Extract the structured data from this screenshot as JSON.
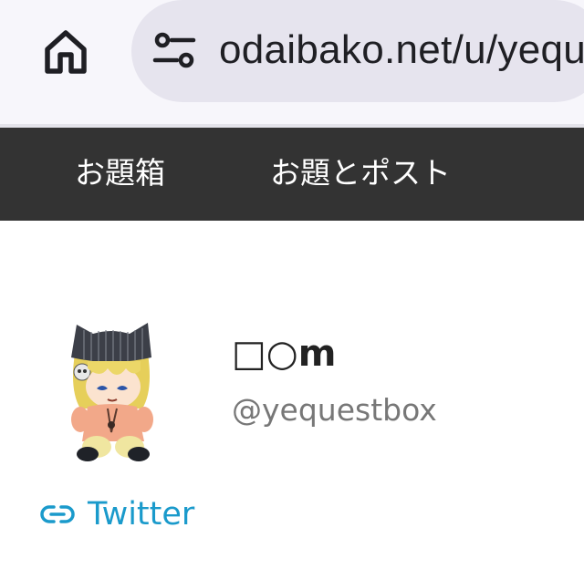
{
  "browser": {
    "url": "odaibako.net/u/yequestbox",
    "home_icon": "home-icon",
    "site_info_icon": "tune-icon"
  },
  "nav": {
    "items": [
      {
        "label": "お題箱"
      },
      {
        "label": "お題とポスト"
      }
    ]
  },
  "profile": {
    "display_name": "□○m",
    "handle": "@yequestbox",
    "avatar_icon": "plush-avatar"
  },
  "links": {
    "twitter_label": "Twitter",
    "link_icon": "link-icon",
    "link_color": "#1a9acb"
  },
  "colors": {
    "navbar": "#333333",
    "chrome": "#f7f6fb",
    "urlbar": "#e6e4ee"
  }
}
